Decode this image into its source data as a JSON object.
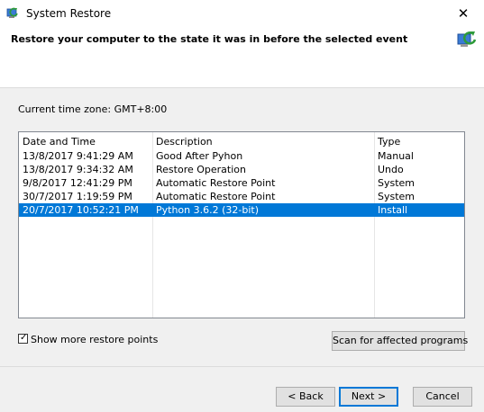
{
  "window": {
    "title": "System Restore",
    "close_glyph": "✕"
  },
  "header": {
    "heading": "Restore your computer to the state it was in before the selected event"
  },
  "timezone": "Current time zone: GMT+8:00",
  "table": {
    "columns": [
      "Date and Time",
      "Description",
      "Type"
    ],
    "rows": [
      {
        "date": "13/8/2017 9:41:29 AM",
        "description": "Good After Pyhon",
        "type": "Manual",
        "selected": false
      },
      {
        "date": "13/8/2017 9:34:32 AM",
        "description": "Restore Operation",
        "type": "Undo",
        "selected": false
      },
      {
        "date": "9/8/2017 12:41:29 PM",
        "description": "Automatic Restore Point",
        "type": "System",
        "selected": false
      },
      {
        "date": "30/7/2017 1:19:59 PM",
        "description": "Automatic Restore Point",
        "type": "System",
        "selected": false
      },
      {
        "date": "20/7/2017 10:52:21 PM",
        "description": "Python 3.6.2 (32-bit)",
        "type": "Install",
        "selected": true
      }
    ]
  },
  "show_more": {
    "label": "Show more restore points",
    "checked": true,
    "check_glyph": "✓"
  },
  "buttons": {
    "scan": "Scan for affected programs",
    "back": "< Back",
    "next": "Next >",
    "cancel": "Cancel"
  },
  "icons": {
    "app": "system-restore-icon",
    "header": "system-restore-icon",
    "sort": "sort-caret-icon"
  },
  "colors": {
    "selection": "#0078d7",
    "default_button_border": "#0078d7"
  }
}
